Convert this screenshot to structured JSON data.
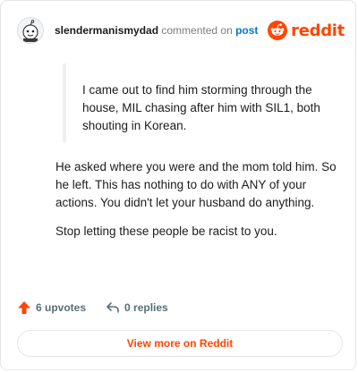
{
  "header": {
    "username": "slendermanismydad",
    "action": " commented on ",
    "post_link": "post",
    "brand": "reddit"
  },
  "quote": {
    "text": "I came out to find him storming through the house, MIL chasing after him with SIL1, both shouting in Korean."
  },
  "comment": {
    "paragraphs": [
      "He asked where you were and the mom told him. So he left. This has nothing to do with ANY of your actions. You didn't let your husband do anything.",
      "Stop letting these people be racist to you."
    ]
  },
  "footer": {
    "upvotes": "6 upvotes",
    "replies": "0 replies"
  },
  "cta": {
    "label": "View more on Reddit"
  },
  "colors": {
    "brand": "#ff4500",
    "link": "#0079d3",
    "muted": "#576f76"
  },
  "icons": [
    "avatar-snoo-icon",
    "reddit-logo-icon",
    "upvote-arrow-icon",
    "reply-arrow-icon"
  ]
}
